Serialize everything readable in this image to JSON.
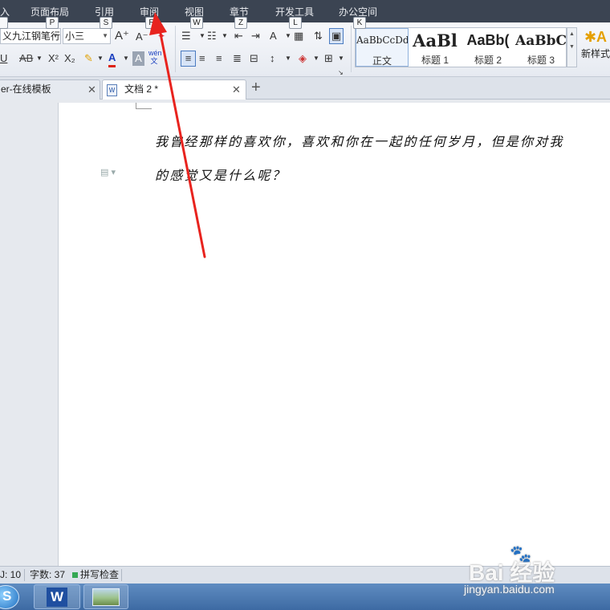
{
  "menubar": {
    "items": [
      "入",
      "页面布局",
      "引用",
      "审阅",
      "视图",
      "章节",
      "开发工具",
      "办公空间"
    ],
    "key_badges": [
      "",
      "P",
      "S",
      "R",
      "W",
      "Z",
      "L",
      "K"
    ]
  },
  "ribbon": {
    "font_name": "义九江钢笔行",
    "font_size": "小三",
    "grow_font": "A⁺",
    "shrink_font": "A⁻",
    "underline": "U",
    "strike": "AB",
    "superscript": "X²",
    "subscript": "X₂",
    "font_color_letter": "A",
    "char_shading": "A",
    "phonetic": "wén 文",
    "styles": [
      {
        "sample": "AaBbCcDd",
        "name": "正文"
      },
      {
        "sample": "AaBl",
        "name": "标题 1"
      },
      {
        "sample": "AaBb(",
        "name": "标题 2"
      },
      {
        "sample": "AaBbC",
        "name": "标题 3"
      }
    ],
    "new_style": "新样式"
  },
  "tabs": [
    {
      "label": "er-在线模板",
      "active": false
    },
    {
      "label": "文档 2 *",
      "active": true
    }
  ],
  "document": {
    "lines": [
      "我曾经那样的喜欢你，喜欢和你在一起的任何岁月，但是你对我",
      "的感觉又是什么呢？"
    ]
  },
  "statusbar": {
    "page_info": "J: 10",
    "word_count": "字数: 37",
    "spell_check": "拼写检查"
  },
  "watermark": {
    "brand": "Bai 经验",
    "url": "jingyan.baidu.com"
  },
  "colors": {
    "menubar_bg": "#3b4452",
    "arrow": "#e8231e",
    "taskbar": "#4a77b0",
    "wps_blue": "#1f4fa0",
    "status_green": "#34a853"
  }
}
